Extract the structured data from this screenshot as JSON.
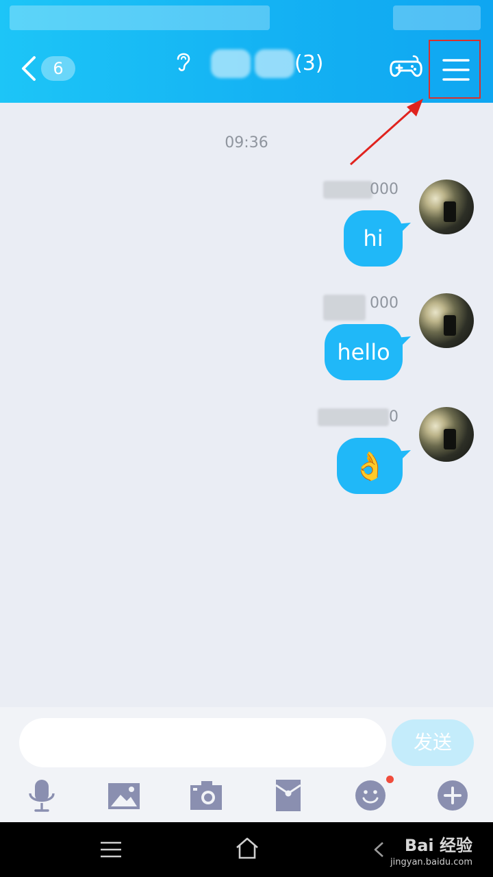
{
  "header": {
    "unread_count": "6",
    "title_suffix": "(3)"
  },
  "chat": {
    "timestamp": "09:36",
    "messages": [
      {
        "sender_suffix": "000",
        "text": "hi"
      },
      {
        "sender_suffix": "000",
        "text": "hello"
      },
      {
        "sender_suffix": "0",
        "text": "👌"
      }
    ]
  },
  "composer": {
    "input_value": "",
    "send_label": "发送"
  },
  "toolbar": {
    "icons": [
      "microphone-icon",
      "image-icon",
      "camera-icon",
      "red-packet-icon",
      "emoji-icon",
      "plus-icon"
    ]
  },
  "watermark": {
    "brand": "Bai 经验",
    "url": "jingyan.baidu.com"
  },
  "colors": {
    "header_start": "#1dc5f7",
    "header_end": "#0fa6f1",
    "bubble": "#20b8f8",
    "highlight": "#d9302c",
    "notification_dot": "#f04c3c"
  }
}
